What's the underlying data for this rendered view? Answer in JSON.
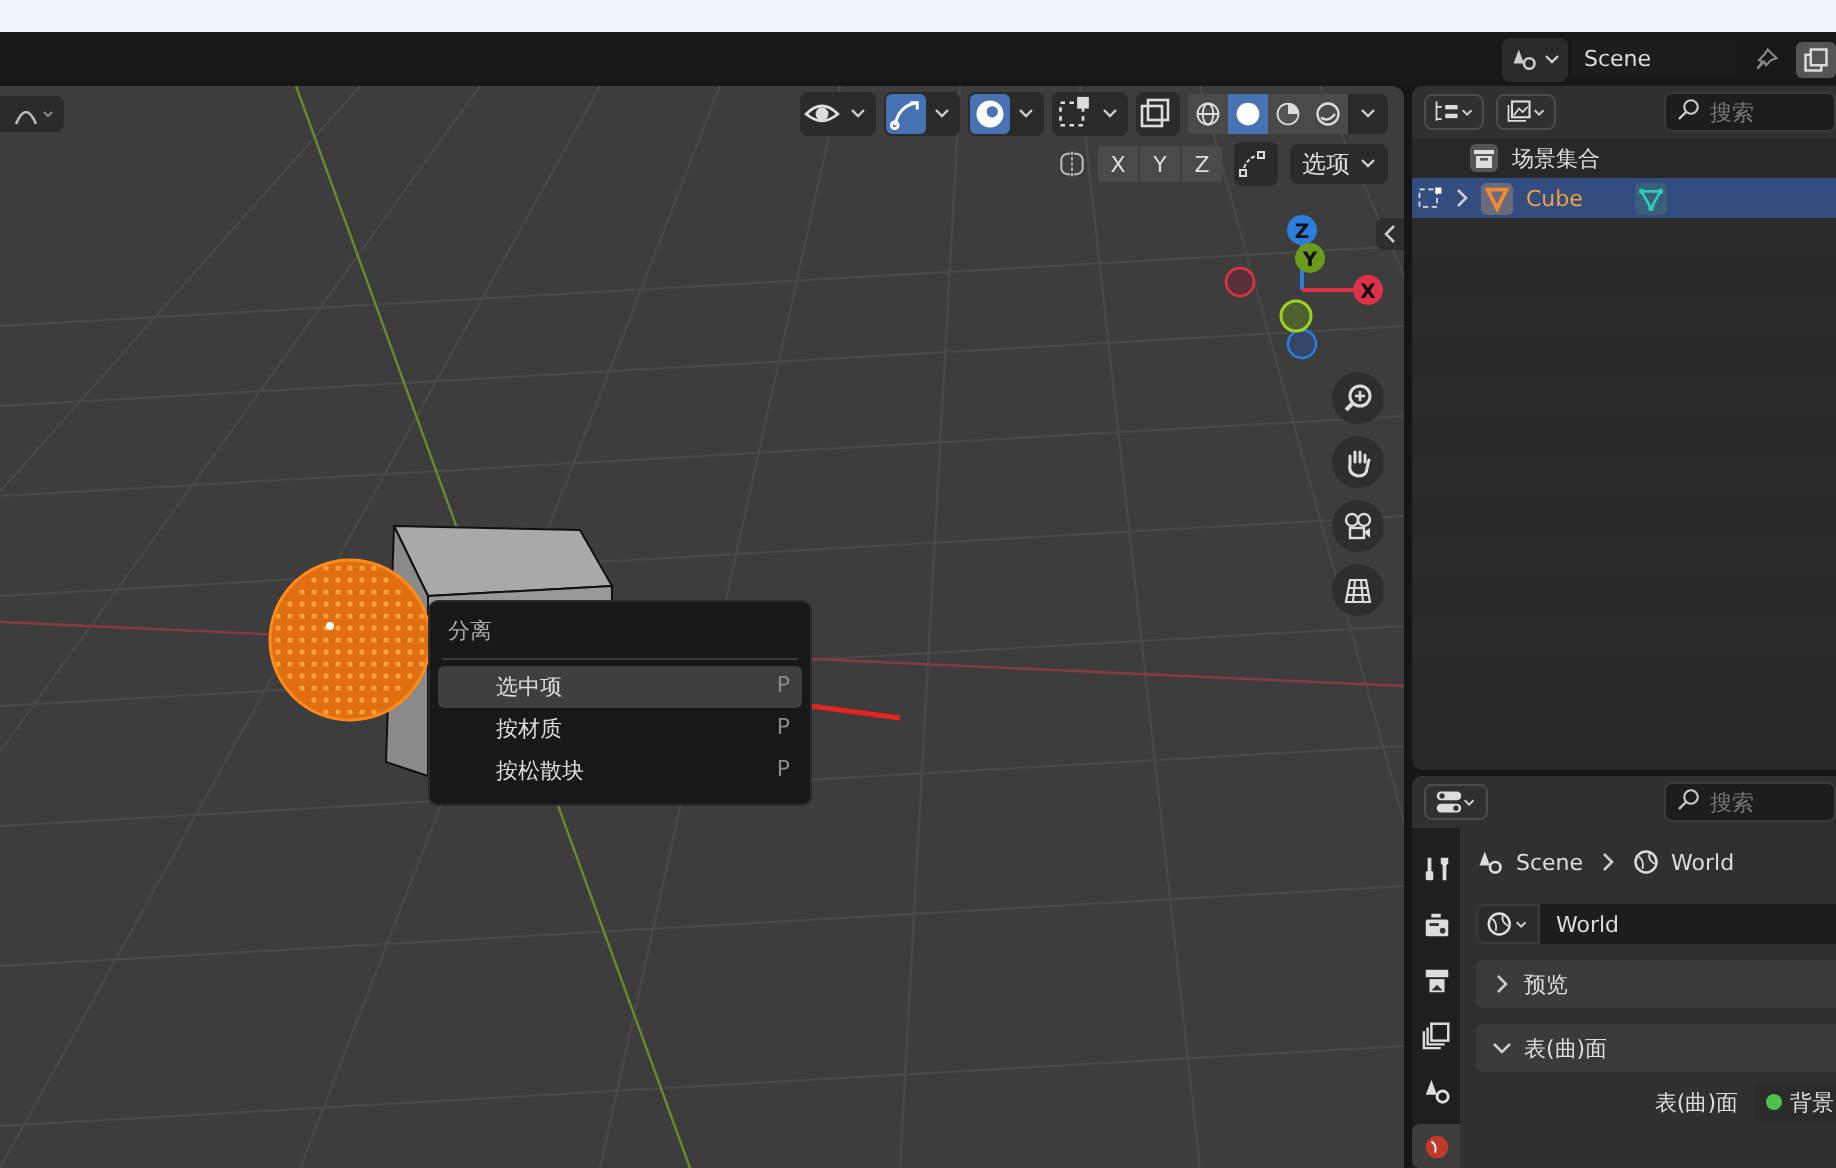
{
  "top_bar": {
    "scene_name": "Scene"
  },
  "viewport": {
    "header_toggles": [
      {
        "kind": "visibility",
        "on": false
      },
      {
        "kind": "gizmo",
        "on": true
      },
      {
        "kind": "overlay",
        "on": true
      },
      {
        "kind": "xray",
        "on": false
      }
    ],
    "shading_modes": [
      {
        "kind": "wireframe",
        "selected": false
      },
      {
        "kind": "solid",
        "selected": true
      },
      {
        "kind": "material",
        "selected": false
      },
      {
        "kind": "rendered",
        "selected": false
      }
    ],
    "mirror_axes": [
      {
        "label": "X",
        "on": false
      },
      {
        "label": "Y",
        "on": false
      },
      {
        "label": "Z",
        "on": false
      }
    ],
    "options_label": "选项",
    "gizmo_axes": [
      {
        "label": "Z",
        "kind": "z"
      },
      {
        "label": "Y",
        "kind": "y"
      },
      {
        "label": "X",
        "kind": "x"
      }
    ]
  },
  "context_menu": {
    "title": "分离",
    "items": [
      {
        "label": "选中项",
        "shortcut": "P",
        "selected": true
      },
      {
        "label": "按材质",
        "shortcut": "P",
        "selected": false
      },
      {
        "label": "按松散块",
        "shortcut": "P",
        "selected": false
      }
    ]
  },
  "outliner": {
    "search_placeholder": "搜索",
    "collection": "场景集合",
    "rows": [
      {
        "label": "Cube",
        "selected": true
      }
    ]
  },
  "properties": {
    "search_placeholder": "搜索",
    "breadcrumb": [
      "Scene",
      "World"
    ],
    "world_field": "World",
    "tabs": [
      {
        "kind": "tool",
        "selected": false
      },
      {
        "kind": "render",
        "selected": false
      },
      {
        "kind": "output",
        "selected": false
      },
      {
        "kind": "view_layer",
        "selected": false
      },
      {
        "kind": "scene",
        "selected": false
      },
      {
        "kind": "world",
        "selected": true
      }
    ],
    "panels": [
      {
        "title": "预览",
        "expanded": false
      },
      {
        "title": "表(曲)面",
        "expanded": true
      }
    ],
    "surface_label": "表(曲)面",
    "surface_value": "背景"
  }
}
